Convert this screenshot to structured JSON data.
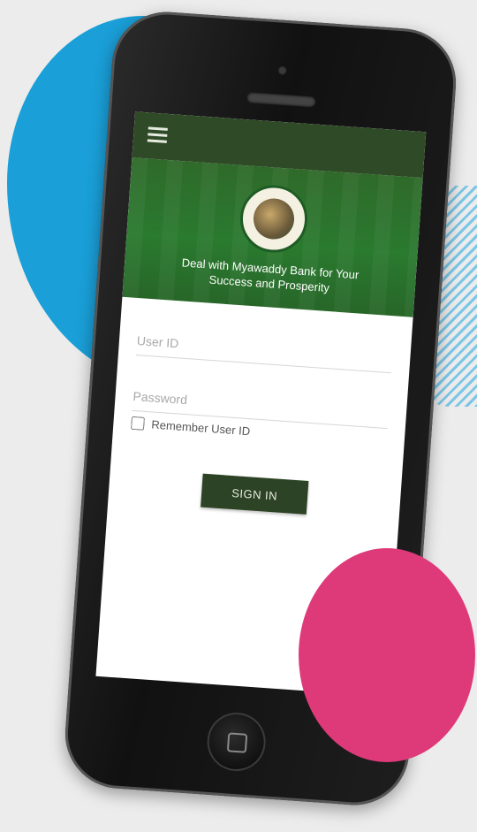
{
  "app": {
    "tagline": "Deal with Myawaddy Bank for Your Success and Prosperity"
  },
  "login": {
    "user_id_placeholder": "User ID",
    "password_placeholder": "Password",
    "remember_label": "Remember User ID",
    "remember_checked": false,
    "sign_in_label": "SIGN IN"
  },
  "icons": {
    "menu": "hamburger-menu-icon",
    "logo": "bank-logo-emblem",
    "home": "home-button-icon"
  },
  "colors": {
    "app_bar": "#2f4a26",
    "banner": "#2a7a2f",
    "button": "#2c4325",
    "blob_blue": "#1a9fd8",
    "blob_pink": "#de3a7a"
  }
}
